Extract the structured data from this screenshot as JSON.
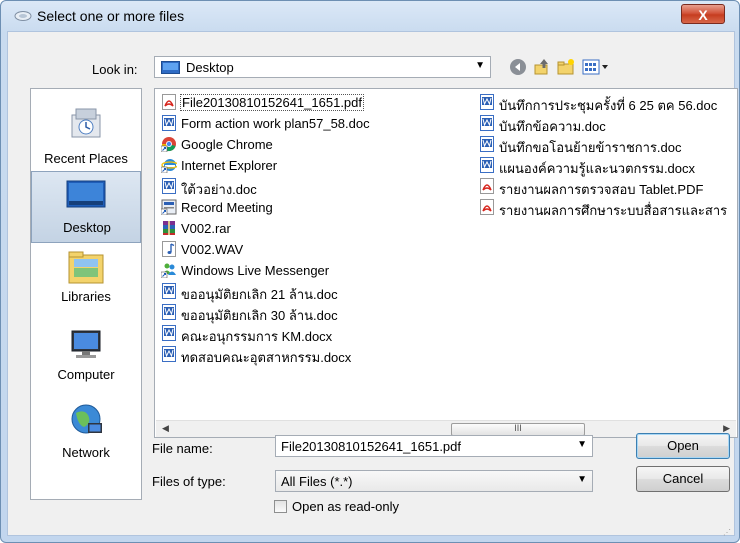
{
  "window": {
    "title": "Select one or more files",
    "close_label": "X"
  },
  "look_in": {
    "label": "Look in:",
    "value": "Desktop"
  },
  "places": [
    {
      "label": "Recent Places",
      "icon": "recent-places-icon",
      "selected": false
    },
    {
      "label": "Desktop",
      "icon": "desktop-icon",
      "selected": true
    },
    {
      "label": "Libraries",
      "icon": "libraries-icon",
      "selected": false
    },
    {
      "label": "Computer",
      "icon": "computer-icon",
      "selected": false
    },
    {
      "label": "Network",
      "icon": "network-icon",
      "selected": false
    }
  ],
  "files_col1": [
    {
      "name": "File20130810152641_1651.pdf",
      "icon": "pdf-icon",
      "selected": true
    },
    {
      "name": "Form action work plan57_58.doc",
      "icon": "word-icon"
    },
    {
      "name": "Google Chrome",
      "icon": "chrome-shortcut-icon"
    },
    {
      "name": "Internet Explorer",
      "icon": "ie-shortcut-icon"
    },
    {
      "name": "ใต้วอย่าง.doc",
      "icon": "word-icon"
    },
    {
      "name": "Record Meeting",
      "icon": "app-shortcut-icon"
    },
    {
      "name": "V002.rar",
      "icon": "rar-icon"
    },
    {
      "name": "V002.WAV",
      "icon": "audio-icon"
    },
    {
      "name": "Windows Live Messenger",
      "icon": "messenger-shortcut-icon"
    },
    {
      "name": "ขออนุมัติยกเลิก 21 ล้าน.doc",
      "icon": "word-icon"
    },
    {
      "name": "ขออนุมัติยกเลิก 30 ล้าน.doc",
      "icon": "word-icon"
    },
    {
      "name": "คณะอนุกรรมการ KM.docx",
      "icon": "word-icon"
    },
    {
      "name": "ทดสอบคณะอุตสาหกรรม.docx",
      "icon": "word-icon"
    }
  ],
  "files_col2": [
    {
      "name": "บันทึกการประชุมครั้งที่ 6 25 ตค 56.doc",
      "icon": "word-icon"
    },
    {
      "name": "บันทึกข้อความ.doc",
      "icon": "word-icon"
    },
    {
      "name": "บันทึกขอโอนย้ายข้าราชการ.doc",
      "icon": "word-icon"
    },
    {
      "name": "แผนองค์ความรู้และนวตกรรม.docx",
      "icon": "word-icon"
    },
    {
      "name": "รายงานผลการตรวจสอบ Tablet.PDF",
      "icon": "pdf-icon"
    },
    {
      "name": "รายงานผลการศึกษาระบบสื่อสารและสาร",
      "icon": "pdf-icon"
    }
  ],
  "scrollbar": {
    "thumb_grip": "III",
    "left_arrow": "◀",
    "right_arrow": "▶"
  },
  "file_name": {
    "label": "File name:",
    "value": "File20130810152641_1651.pdf"
  },
  "file_type": {
    "label": "Files of type:",
    "value": "All Files (*.*)"
  },
  "readonly": {
    "label": "Open as read-only",
    "checked": false
  },
  "buttons": {
    "open": "Open",
    "cancel": "Cancel"
  },
  "colors": {
    "accent": "#3c7fb1",
    "title_bg": "#c7daf0",
    "close_red": "#c63d20"
  }
}
